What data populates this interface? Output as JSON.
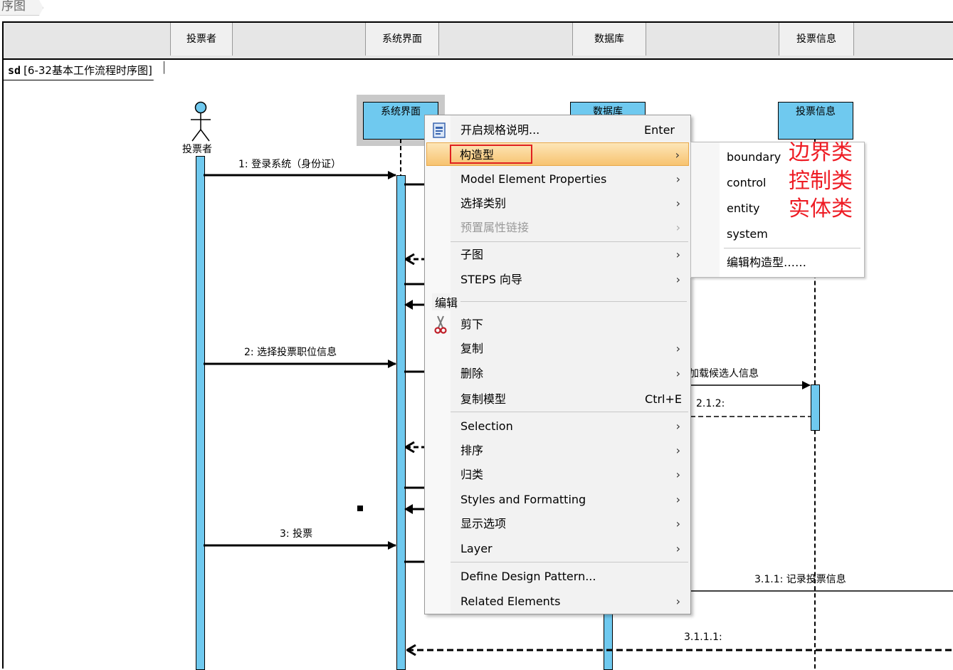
{
  "tab": {
    "title": "序图"
  },
  "header": {
    "columns": [
      "投票者",
      "系统界面",
      "数据库",
      "投票信息"
    ]
  },
  "diagram": {
    "frame_keyword": "sd",
    "frame_title": "[6-32基本工作流程时序图]",
    "actor": "投票者",
    "lifelines": [
      "系统界面",
      "数据库",
      "投票信息"
    ],
    "messages": [
      {
        "label": "1: 登录系统（身份证）"
      },
      {
        "label": "2: 选择投票职位信息"
      },
      {
        "label": "加载候选人信息"
      },
      {
        "label": "2.1.2:"
      },
      {
        "label": "3: 投票"
      },
      {
        "label": "3.1.1: 记录投票信息"
      },
      {
        "label": "3.1.1.1:"
      }
    ]
  },
  "context_menu": {
    "items": [
      {
        "label": "开启规格说明...",
        "shortcut": "Enter",
        "icon": "spec-icon"
      },
      {
        "label": "构造型",
        "has_submenu": true,
        "highlighted": true
      },
      {
        "label": "Model Element Properties",
        "has_submenu": true
      },
      {
        "label": "选择类别",
        "has_submenu": true
      },
      {
        "label": "预置属性链接",
        "has_submenu": true,
        "disabled": true
      },
      {
        "label": "子图",
        "has_submenu": true
      },
      {
        "label": "STEPS 向导",
        "has_submenu": true
      },
      {
        "section": "编辑"
      },
      {
        "label": "剪下",
        "icon": "scissors-icon"
      },
      {
        "label": "复制",
        "has_submenu": true
      },
      {
        "label": "删除",
        "has_submenu": true
      },
      {
        "label": "复制模型",
        "shortcut": "Ctrl+E"
      },
      {
        "label": "Selection",
        "has_submenu": true
      },
      {
        "label": "排序",
        "has_submenu": true
      },
      {
        "label": "归类",
        "has_submenu": true
      },
      {
        "label": "Styles and Formatting",
        "has_submenu": true
      },
      {
        "label": "显示选项",
        "has_submenu": true
      },
      {
        "label": "Layer",
        "has_submenu": true
      },
      {
        "label": "Define Design Pattern..."
      },
      {
        "label": "Related Elements",
        "has_submenu": true
      }
    ]
  },
  "stereotype_submenu": {
    "items": [
      "boundary",
      "control",
      "entity",
      "system"
    ],
    "edit_label": "编辑构造型……"
  },
  "annotations": [
    "边界类",
    "控制类",
    "实体类"
  ],
  "colors": {
    "lifeline_fill": "#6fc9ef",
    "highlight": "#f7c370",
    "annotation": "#ee1c24",
    "highlight_border": "#e02020"
  }
}
